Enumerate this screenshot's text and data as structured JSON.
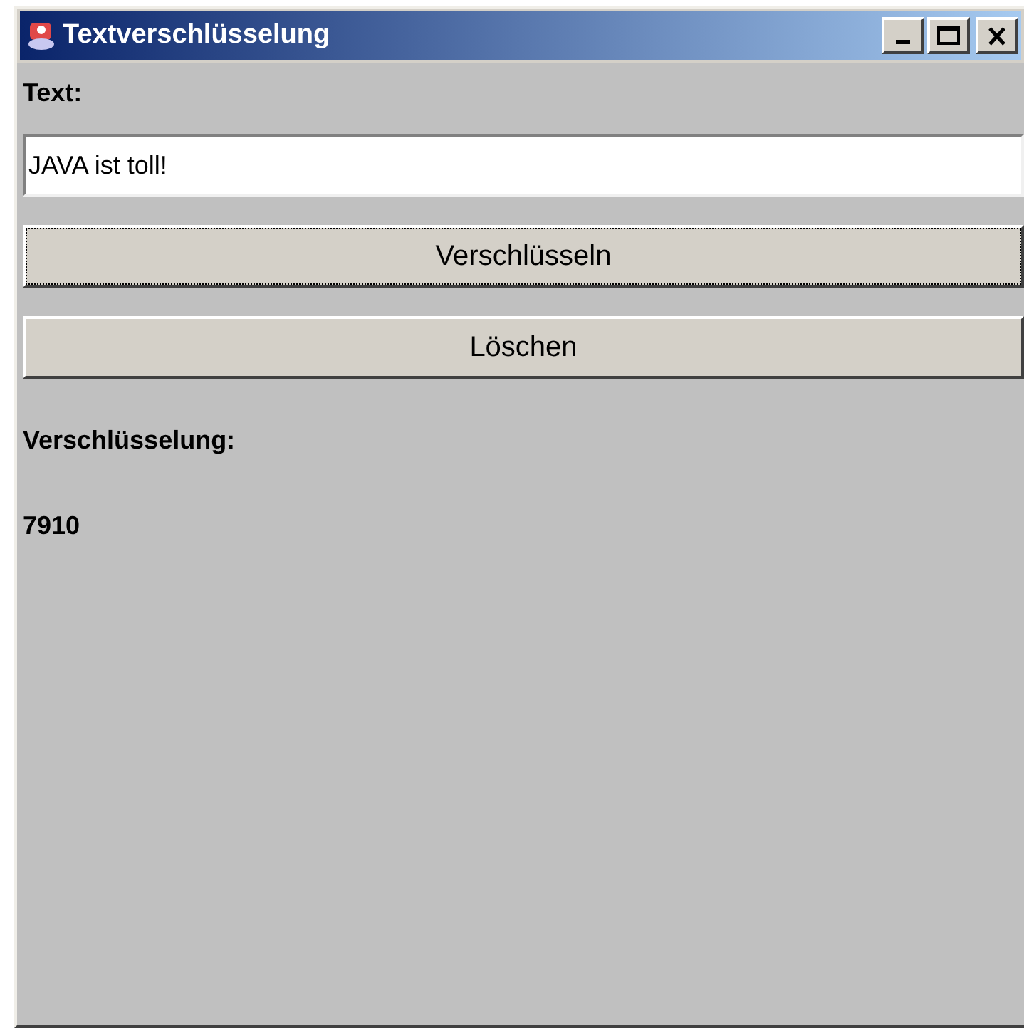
{
  "window": {
    "title": "Textverschlüsselung"
  },
  "text_label": "Text:",
  "text_field": {
    "value": "JAVA ist toll!"
  },
  "buttons": [
    {
      "label": "Verschlüsseln",
      "focused": true
    },
    {
      "label": "Löschen",
      "focused": false
    }
  ],
  "result_label": "Verschlüsselung:",
  "result_value": "7910"
}
